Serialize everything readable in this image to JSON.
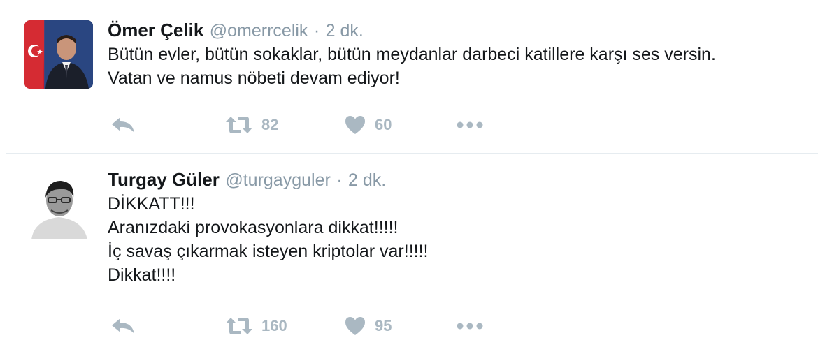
{
  "tweets": [
    {
      "fullname": "Ömer Çelik",
      "username": "@omerrcelik",
      "separator": "·",
      "time": "2 dk.",
      "lines": [
        "Bütün evler, bütün sokaklar, bütün meydanlar darbeci katillere karşı ses versin.",
        "Vatan ve namus nöbeti devam ediyor!"
      ],
      "retweets": "82",
      "likes": "60"
    },
    {
      "fullname": "Turgay Güler",
      "username": "@turgayguler",
      "separator": "·",
      "time": "2 dk.",
      "lines": [
        "DİKKATT!!!",
        "Aranızdaki provokasyonlara dikkat!!!!!",
        "İç savaş çıkarmak isteyen kriptolar var!!!!!",
        "Dikkat!!!!"
      ],
      "retweets": "160",
      "likes": "95"
    }
  ],
  "icons": {
    "reply": "reply-icon",
    "retweet": "retweet-icon",
    "like": "heart-icon",
    "more": "more-icon"
  },
  "colors": {
    "action_gray": "#aab8c2",
    "meta_gray": "#8899a6",
    "divider": "#e6ecf0",
    "text": "#14171a"
  }
}
